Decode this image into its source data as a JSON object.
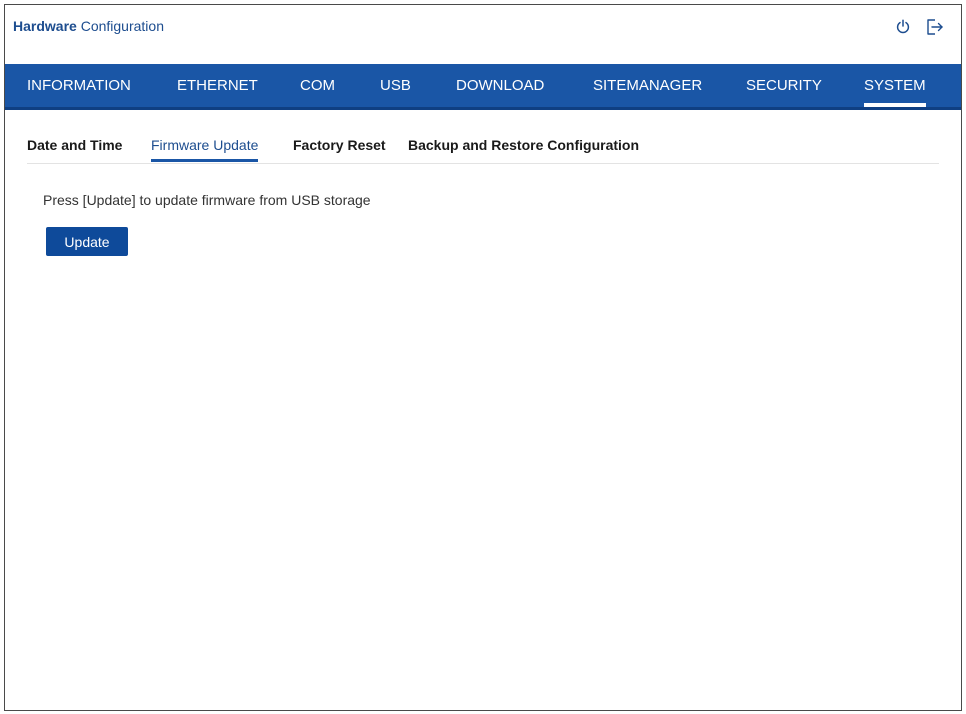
{
  "header": {
    "title_bold": "Hardware",
    "title_rest": " Configuration",
    "icons": [
      "power-icon",
      "logout-icon"
    ]
  },
  "mainnav": {
    "items": [
      {
        "label": "INFORMATION"
      },
      {
        "label": "ETHERNET"
      },
      {
        "label": "COM"
      },
      {
        "label": "USB"
      },
      {
        "label": "DOWNLOAD"
      },
      {
        "label": "SITEMANAGER"
      },
      {
        "label": "SECURITY"
      },
      {
        "label": "SYSTEM",
        "active": true
      }
    ]
  },
  "subtabs": {
    "items": [
      {
        "label": "Date and Time"
      },
      {
        "label": "Firmware Update",
        "active": true
      },
      {
        "label": "Factory Reset"
      },
      {
        "label": "Backup and Restore Configuration"
      }
    ]
  },
  "content": {
    "instruction": "Press [Update] to update firmware from USB storage",
    "update_label": "Update"
  },
  "colors": {
    "nav_bg": "#1a56a6",
    "accent": "#1d4d8f",
    "button_bg": "#0e4a9a"
  }
}
